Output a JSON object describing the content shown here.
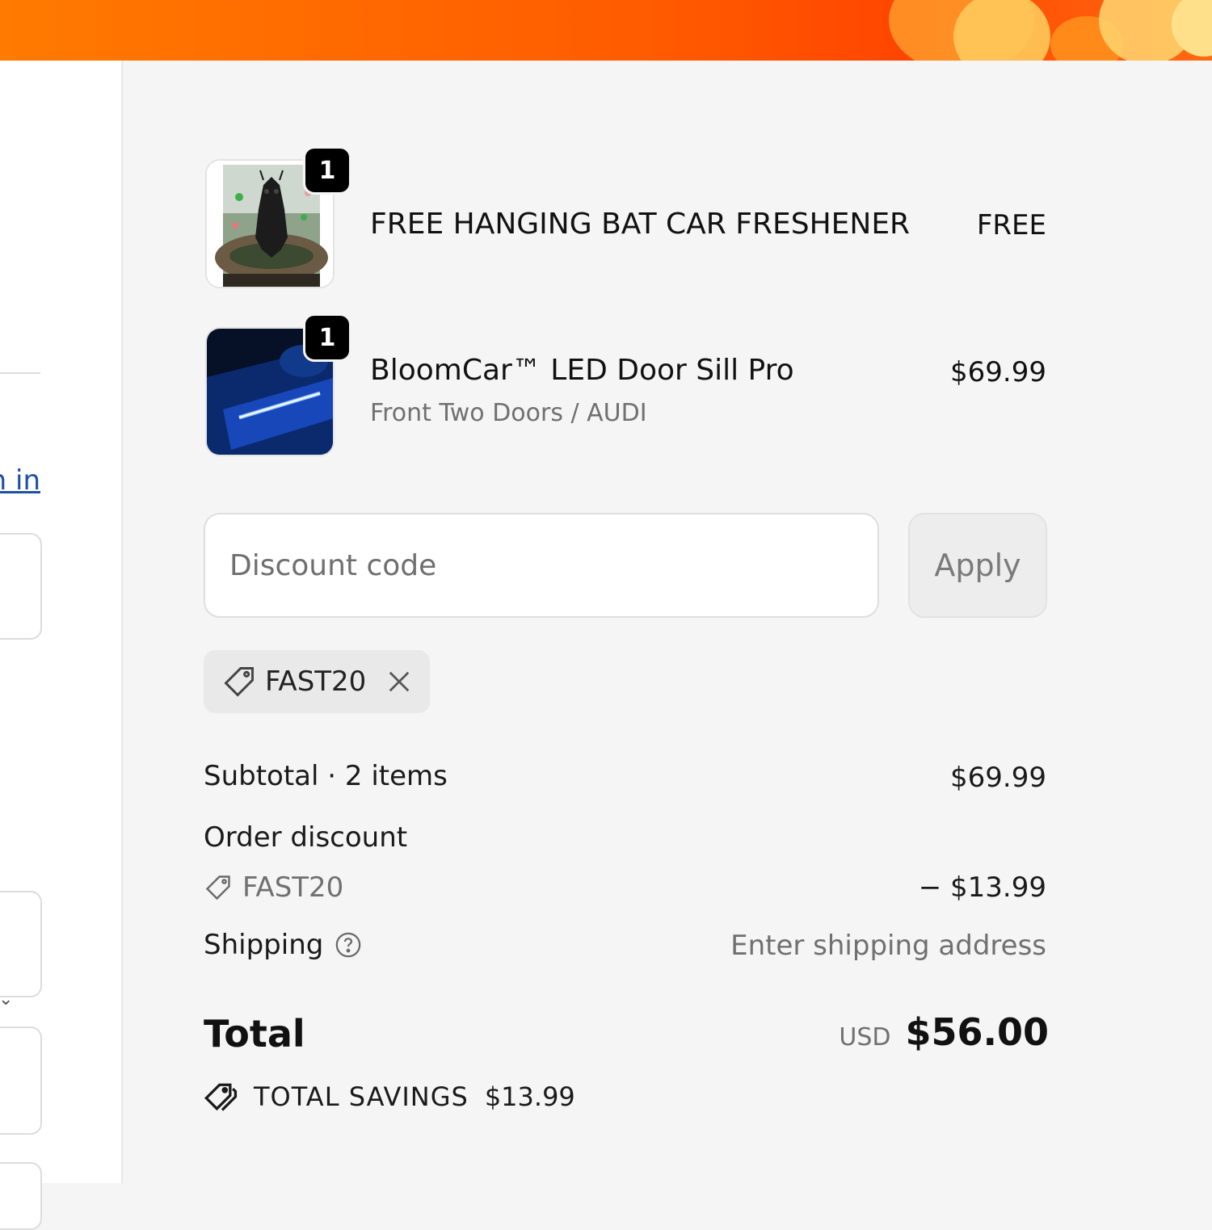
{
  "cart": {
    "items": [
      {
        "quantity": "1",
        "name": "FREE HANGING BAT CAR FRESHENER",
        "price": "FREE",
        "variant": "",
        "image": "bat-car-freshener-thumbnail"
      },
      {
        "quantity": "1",
        "name": "BloomCar™ LED Door Sill Pro",
        "price": "$69.99",
        "variant": "Front Two Doors / AUDI",
        "image": "led-door-sill-thumbnail"
      }
    ]
  },
  "left_pane": {
    "link_text": "n in"
  },
  "discount": {
    "placeholder": "Discount code",
    "apply_label": "Apply",
    "applied_code": "FAST20"
  },
  "summary": {
    "subtotal_label": "Subtotal · 2 items",
    "subtotal_value": "$69.99",
    "order_discount_label": "Order discount",
    "order_discount_code": "FAST20",
    "order_discount_value": "− $13.99",
    "shipping_label": "Shipping",
    "shipping_value": "Enter shipping address",
    "total_label": "Total",
    "currency": "USD",
    "total_value": "$56.00",
    "savings_label": "TOTAL SAVINGS",
    "savings_value": "$13.99"
  },
  "colors": {
    "banner": "#ff5a00",
    "link": "#1f4fa8",
    "badge": "#000000",
    "background": "#f5f5f5"
  },
  "icons": [
    "tag-icon",
    "close-icon",
    "help-circle-icon",
    "tags-icon",
    "chevron-down-icon"
  ]
}
